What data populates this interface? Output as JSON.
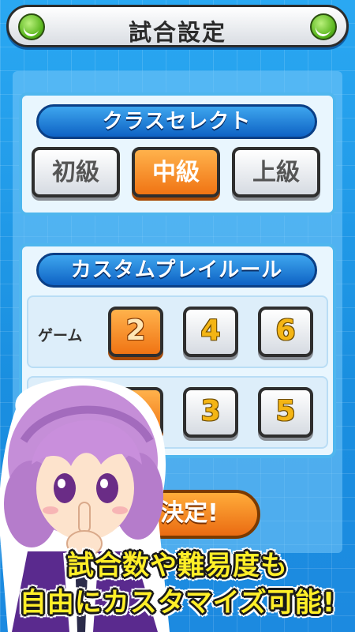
{
  "header": {
    "title": "試合設定",
    "left_icon": "tennis-ball-icon",
    "right_icon": "tennis-ball-icon"
  },
  "class_select": {
    "title": "クラスセレクト",
    "options": [
      {
        "label": "初級",
        "selected": false
      },
      {
        "label": "中級",
        "selected": true
      },
      {
        "label": "上級",
        "selected": false
      }
    ]
  },
  "custom_rules": {
    "title": "カスタムプレイルール",
    "games_label": "ゲーム",
    "games_options": [
      {
        "label": "2",
        "selected": true
      },
      {
        "label": "4",
        "selected": false
      },
      {
        "label": "6",
        "selected": false
      }
    ],
    "second_row_options": [
      {
        "label": "",
        "selected": true
      },
      {
        "label": "3",
        "selected": false
      },
      {
        "label": "5",
        "selected": false
      }
    ]
  },
  "decide_button": {
    "label": "決定!"
  },
  "caption": {
    "line1": "試合数や難易度も",
    "line2": "自由にカスタマイズ可能!"
  },
  "colors": {
    "accent_orange": "#f07414",
    "caption_yellow": "#ffef28",
    "ribbon_blue": "#0e62c4"
  }
}
